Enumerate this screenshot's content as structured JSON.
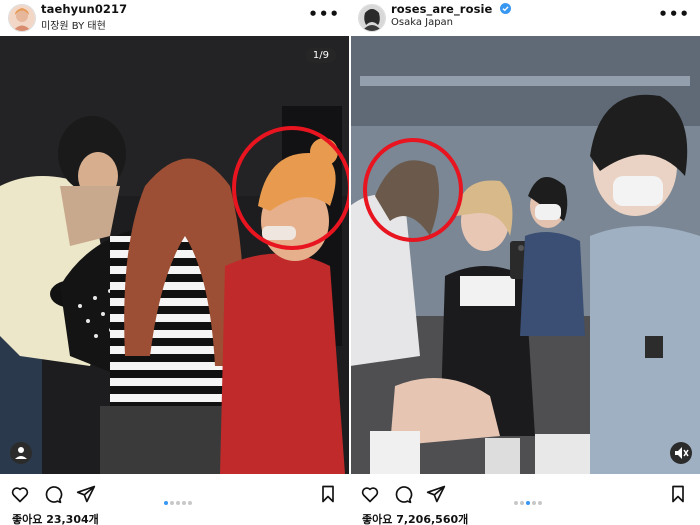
{
  "posts": [
    {
      "username": "taehyun0217",
      "subline": "미장원 BY 태현",
      "more_label": "•••",
      "photo_counter": "1/9",
      "carousel": {
        "count": 5,
        "active": 1
      },
      "likes_text": "좋아요 23,304개",
      "highlight_circle_color": "#e8141f"
    },
    {
      "username": "roses_are_rosie",
      "verified": true,
      "subline": "Osaka Japan",
      "more_label": "•••",
      "carousel": {
        "count": 5,
        "active": 3
      },
      "likes_text": "좋아요 7,206,560개",
      "highlight_circle_color": "#e8141f",
      "video_muted": true
    }
  ],
  "icons": [
    "heart-icon",
    "comment-icon",
    "share-icon",
    "bookmark-icon",
    "more-icon",
    "user-tag-icon",
    "mute-icon",
    "verified-badge-icon"
  ],
  "colors": {
    "accent_blue": "#3897f0",
    "circle_red": "#e8141f",
    "text": "#111111"
  }
}
